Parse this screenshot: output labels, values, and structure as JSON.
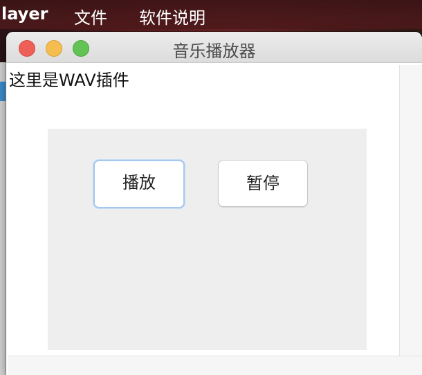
{
  "menubar": {
    "app_name": "layer",
    "items": [
      "文件",
      "软件说明"
    ]
  },
  "window": {
    "title": "音乐播放器",
    "plugin_label": "这里是WAV插件",
    "buttons": {
      "play_label": "播放",
      "pause_label": "暂停"
    }
  },
  "colors": {
    "close": "#ee5f58",
    "minimize": "#f5bd4f",
    "zoom": "#61c454",
    "panel": "#eeeeee",
    "focus_ring": "#a6c8ef"
  }
}
